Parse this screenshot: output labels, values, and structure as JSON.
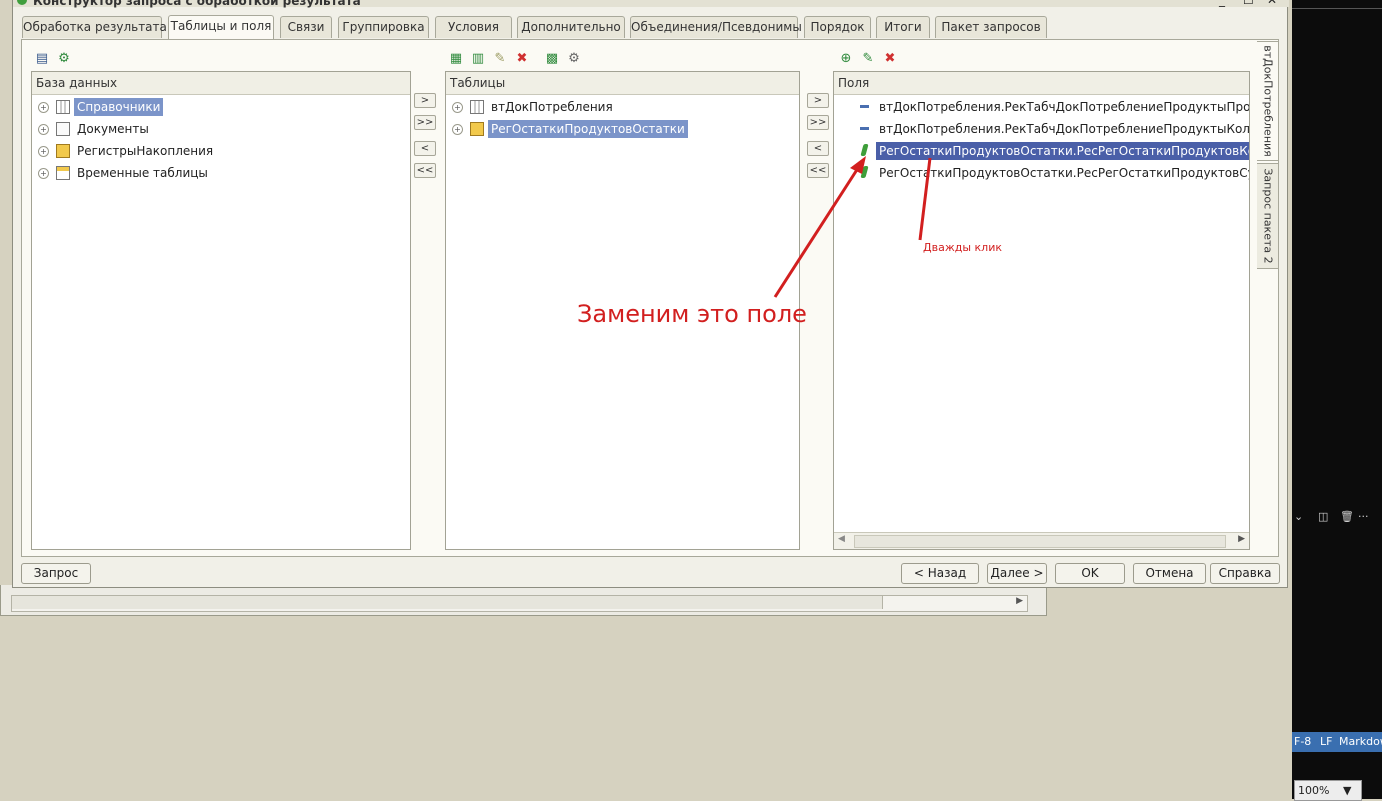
{
  "window": {
    "title": "Конструктор запроса с обработкой результата"
  },
  "tabs": [
    {
      "label": "Обработка результата"
    },
    {
      "label": "Таблицы и поля"
    },
    {
      "label": "Связи"
    },
    {
      "label": "Группировка"
    },
    {
      "label": "Условия"
    },
    {
      "label": "Дополнительно"
    },
    {
      "label": "Объединения/Псевдонимы"
    },
    {
      "label": "Порядок"
    },
    {
      "label": "Итоги"
    },
    {
      "label": "Пакет запросов"
    }
  ],
  "active_tab": "Таблицы и поля",
  "side_tabs": [
    {
      "label": "втДокПотребления"
    },
    {
      "label": "Запрос пакета 2"
    }
  ],
  "database_panel": {
    "header": "База данных",
    "items": [
      {
        "label": "Справочники",
        "icon": "catalog-icon",
        "selected": true
      },
      {
        "label": "Документы",
        "icon": "document-icon"
      },
      {
        "label": "РегистрыНакопления",
        "icon": "register-icon"
      },
      {
        "label": "Временные таблицы",
        "icon": "temp-table-icon"
      }
    ]
  },
  "tables_panel": {
    "header": "Таблицы",
    "items": [
      {
        "label": "втДокПотребления",
        "icon": "table-icon"
      },
      {
        "label": "РегОстаткиПродуктовОстатки",
        "icon": "register-icon",
        "selected": true
      }
    ]
  },
  "fields_panel": {
    "header": "Поля",
    "items": [
      {
        "label": "втДокПотребления.РекТабчДокПотреблениеПродуктыПродукт",
        "icon": "dimension-icon"
      },
      {
        "label": "втДокПотребления.РекТабчДокПотреблениеПродуктыКоличество",
        "icon": "dimension-icon"
      },
      {
        "label": "РегОстаткиПродуктовОстатки.РесРегОстаткиПродуктовКоличествоОстаток",
        "icon": "resource-icon",
        "selected": true
      },
      {
        "label": "РегОстаткиПродуктовОстатки.РесРегОстаткиПродуктовСуммаОстаток",
        "icon": "resource-icon"
      }
    ]
  },
  "move_buttons": {
    "add": ">",
    "add_all": ">>",
    "remove": "<",
    "remove_all": "<<"
  },
  "buttons": {
    "query": "Запрос",
    "back": "< Назад",
    "next": "Далее >",
    "ok": "OK",
    "cancel": "Отмена",
    "help": "Справка"
  },
  "annotations": {
    "main": "Заменим это поле",
    "secondary": "Дважды клик",
    "color": "#d21f1f"
  },
  "editor": {
    "encoding": "F-8",
    "line_ending": "LF",
    "language": "Markdow",
    "zoom": "100%"
  },
  "colors": {
    "selection": "#7b94c9",
    "selection_strong": "#4a5fa8",
    "dialog_bg": "#f1f0e8"
  }
}
